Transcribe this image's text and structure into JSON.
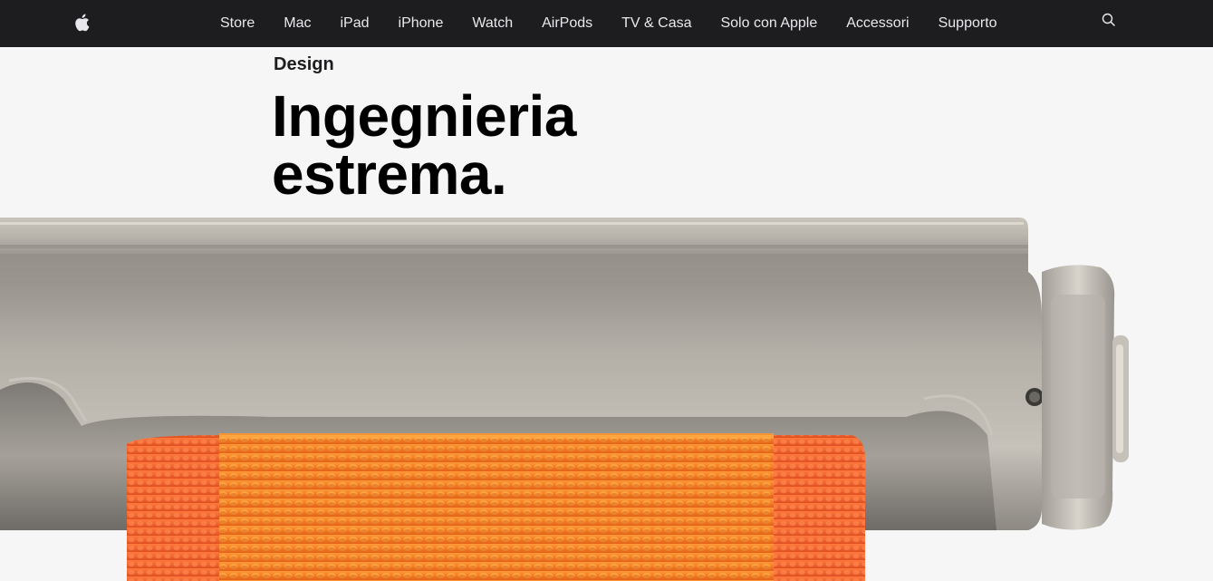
{
  "nav": {
    "logo_icon": "apple-logo-icon",
    "items": [
      {
        "label": "Store"
      },
      {
        "label": "Mac"
      },
      {
        "label": "iPad"
      },
      {
        "label": "iPhone"
      },
      {
        "label": "Watch"
      },
      {
        "label": "AirPods"
      },
      {
        "label": "TV & Casa"
      },
      {
        "label": "Solo con Apple"
      },
      {
        "label": "Accessori"
      },
      {
        "label": "Supporto"
      }
    ],
    "search_icon": "search-icon",
    "background": "#1d1d1f",
    "text_color": "#e8e8ed"
  },
  "hero": {
    "eyebrow": "Design",
    "headline_line1": "Ingegnieria",
    "headline_line2": "estrema.",
    "image": "apple-watch-ultra-side-orange-band",
    "band_color": "#f47a1f",
    "case_color": "#a8a49c"
  }
}
